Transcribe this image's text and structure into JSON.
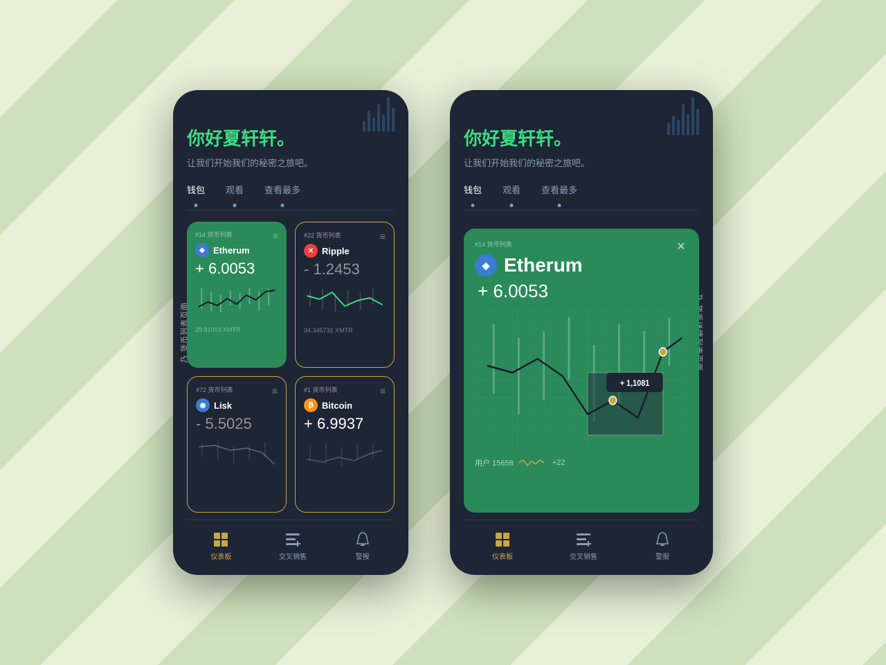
{
  "background": {
    "color": "#d4e8c2"
  },
  "left_phone": {
    "vertical_label": "乃 货币列表页面",
    "greeting_title": "你好夏轩轩。",
    "greeting_sub": "让我们开始我们的秘密之旅吧。",
    "tabs": [
      {
        "label": "钱包",
        "active": true
      },
      {
        "label": "观看",
        "active": false
      },
      {
        "label": "查看最多",
        "active": false
      }
    ],
    "cards": [
      {
        "tag": "#14 货币列表",
        "coin": "Etherum",
        "coin_type": "eth",
        "value": "+ 6.0053",
        "value_class": "positive",
        "bottom": "29.81003 XMTR",
        "style": "green"
      },
      {
        "tag": "#22 货币列表",
        "coin": "Ripple",
        "coin_type": "xrp",
        "value": "- 1.2453",
        "value_class": "negative",
        "bottom": "34.345731 XMTR",
        "style": "dark"
      },
      {
        "tag": "#72 货币列表",
        "coin": "Lisk",
        "coin_type": "lsk",
        "value": "- 5.5025",
        "value_class": "negative",
        "bottom": "",
        "style": "dark"
      },
      {
        "tag": "#1 货币列表",
        "coin": "Bitcoin",
        "coin_type": "btc",
        "value": "+ 6.9937",
        "value_class": "positive",
        "bottom": "",
        "style": "dark"
      }
    ],
    "bottom_nav": [
      {
        "label": "仪表板",
        "icon": "⊞",
        "active": true
      },
      {
        "label": "交叉销售",
        "icon": "⊟",
        "active": false
      },
      {
        "label": "警报",
        "icon": "🔔",
        "active": false
      }
    ]
  },
  "right_phone": {
    "vertical_label": "乃 货币详情列表页面",
    "greeting_title": "你好夏轩轩。",
    "greeting_sub": "让我们开始我们的秘密之旅吧。",
    "tabs": [
      {
        "label": "钱包",
        "active": true
      },
      {
        "label": "观看",
        "active": false
      },
      {
        "label": "查看最多",
        "active": false
      }
    ],
    "detail_card": {
      "tag": "#14 货币列表",
      "coin": "Etherum",
      "coin_type": "eth",
      "value": "+ 6.0053",
      "tooltip": "+ 1,1081",
      "footer_users": "用户 15658",
      "footer_count": "+22"
    },
    "bottom_nav": [
      {
        "label": "仪表板",
        "icon": "⊞",
        "active": true
      },
      {
        "label": "交叉销售",
        "icon": "⊟",
        "active": false
      },
      {
        "label": "警报",
        "icon": "🔔",
        "active": false
      }
    ]
  }
}
